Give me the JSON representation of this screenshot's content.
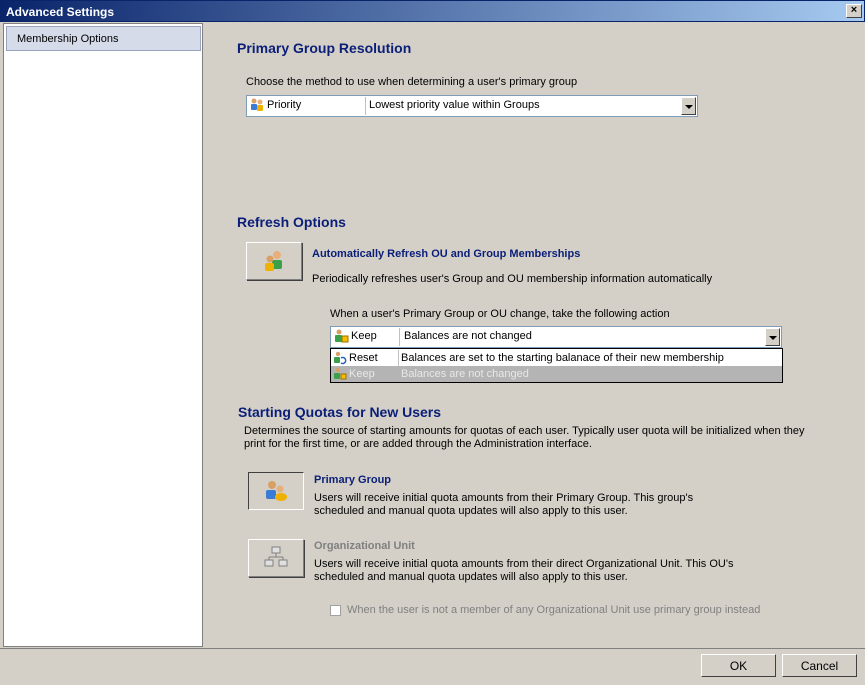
{
  "window": {
    "title": "Advanced Settings",
    "close_label": "×"
  },
  "sidebar": {
    "items": [
      {
        "label": "Membership Options"
      }
    ]
  },
  "primary_group_resolution": {
    "heading": "Primary Group Resolution",
    "description": "Choose the method to use when determining a user's primary group",
    "combo": {
      "key": "Priority",
      "value": "Lowest priority value within Groups"
    }
  },
  "refresh_options": {
    "heading": "Refresh Options",
    "auto_refresh_title": "Automatically Refresh OU and Group Memberships",
    "auto_refresh_desc": "Periodically refreshes user's Group and OU membership information automatically",
    "action_prompt": "When a user's Primary Group or OU change, take the following action",
    "combo": {
      "key": "Keep",
      "value": "Balances are not changed"
    },
    "dropdown_options": [
      {
        "key": "Reset",
        "value": "Balances are set to the starting balanace of their new membership"
      },
      {
        "key": "Keep",
        "value": "Balances are not changed"
      }
    ]
  },
  "starting_quotas": {
    "heading": "Starting Quotas for New Users",
    "description_line1": "Determines the source of starting amounts for quotas of each user.  Typically user quota will be initialized when they",
    "description_line2": "print for the first time, or are added through the Administration interface.",
    "primary_group": {
      "title": "Primary Group",
      "line1": "Users will receive initial quota amounts from their Primary Group.  This group's",
      "line2": "scheduled and manual quota updates will also apply to this user."
    },
    "organizational_unit": {
      "title": "Organizational Unit",
      "line1": "Users will receive initial quota amounts from their direct Organizational Unit.  This OU's",
      "line2": "scheduled and manual quota updates will also apply to this user."
    },
    "fallback_checkbox": "When the user is not a member of any Organizational Unit use primary group instead"
  },
  "footer": {
    "ok_label": "OK",
    "cancel_label": "Cancel"
  },
  "colors": {
    "heading": "#0a1e78",
    "dropdown_highlight": "#b4b4b4",
    "titlebar": "#0a246a"
  }
}
